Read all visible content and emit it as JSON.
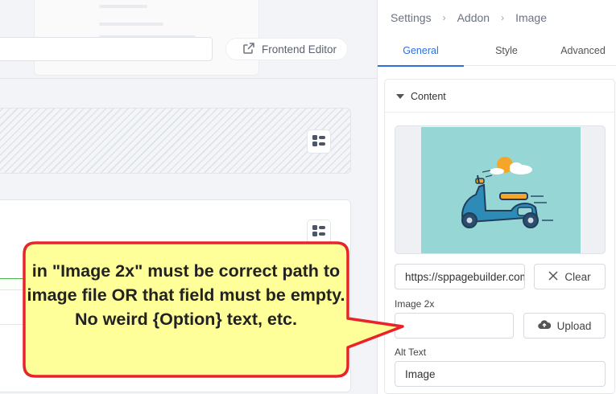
{
  "toolbar": {
    "frontend_editor_label": "Frontend Editor",
    "url_value": ""
  },
  "panel": {
    "breadcrumb": [
      "Settings",
      "Addon",
      "Image"
    ],
    "tabs": [
      {
        "label": "General",
        "active": true
      },
      {
        "label": "Style",
        "active": false
      },
      {
        "label": "Advanced",
        "active": false
      }
    ],
    "section_title": "Content",
    "image_url_value": "https://sppagebuilder.com",
    "clear_label": "Clear",
    "image2x_label": "Image 2x",
    "image2x_value": "",
    "upload_label": "Upload",
    "alt_text_label": "Alt Text",
    "alt_text_value": "Image"
  },
  "callout": {
    "text": "in \"Image 2x\" must be correct path to image file OR that field must be empty. No weird {Option} text, etc."
  },
  "colors": {
    "accent": "#2b6fe3",
    "callout_fill": "#ffff99",
    "callout_border": "#e8232a",
    "image_bg": "#96d6d5"
  },
  "icons": [
    "external-link-icon",
    "grip-icon",
    "chevron-right-icon",
    "caret-down-icon",
    "close-icon",
    "cloud-upload-icon"
  ]
}
